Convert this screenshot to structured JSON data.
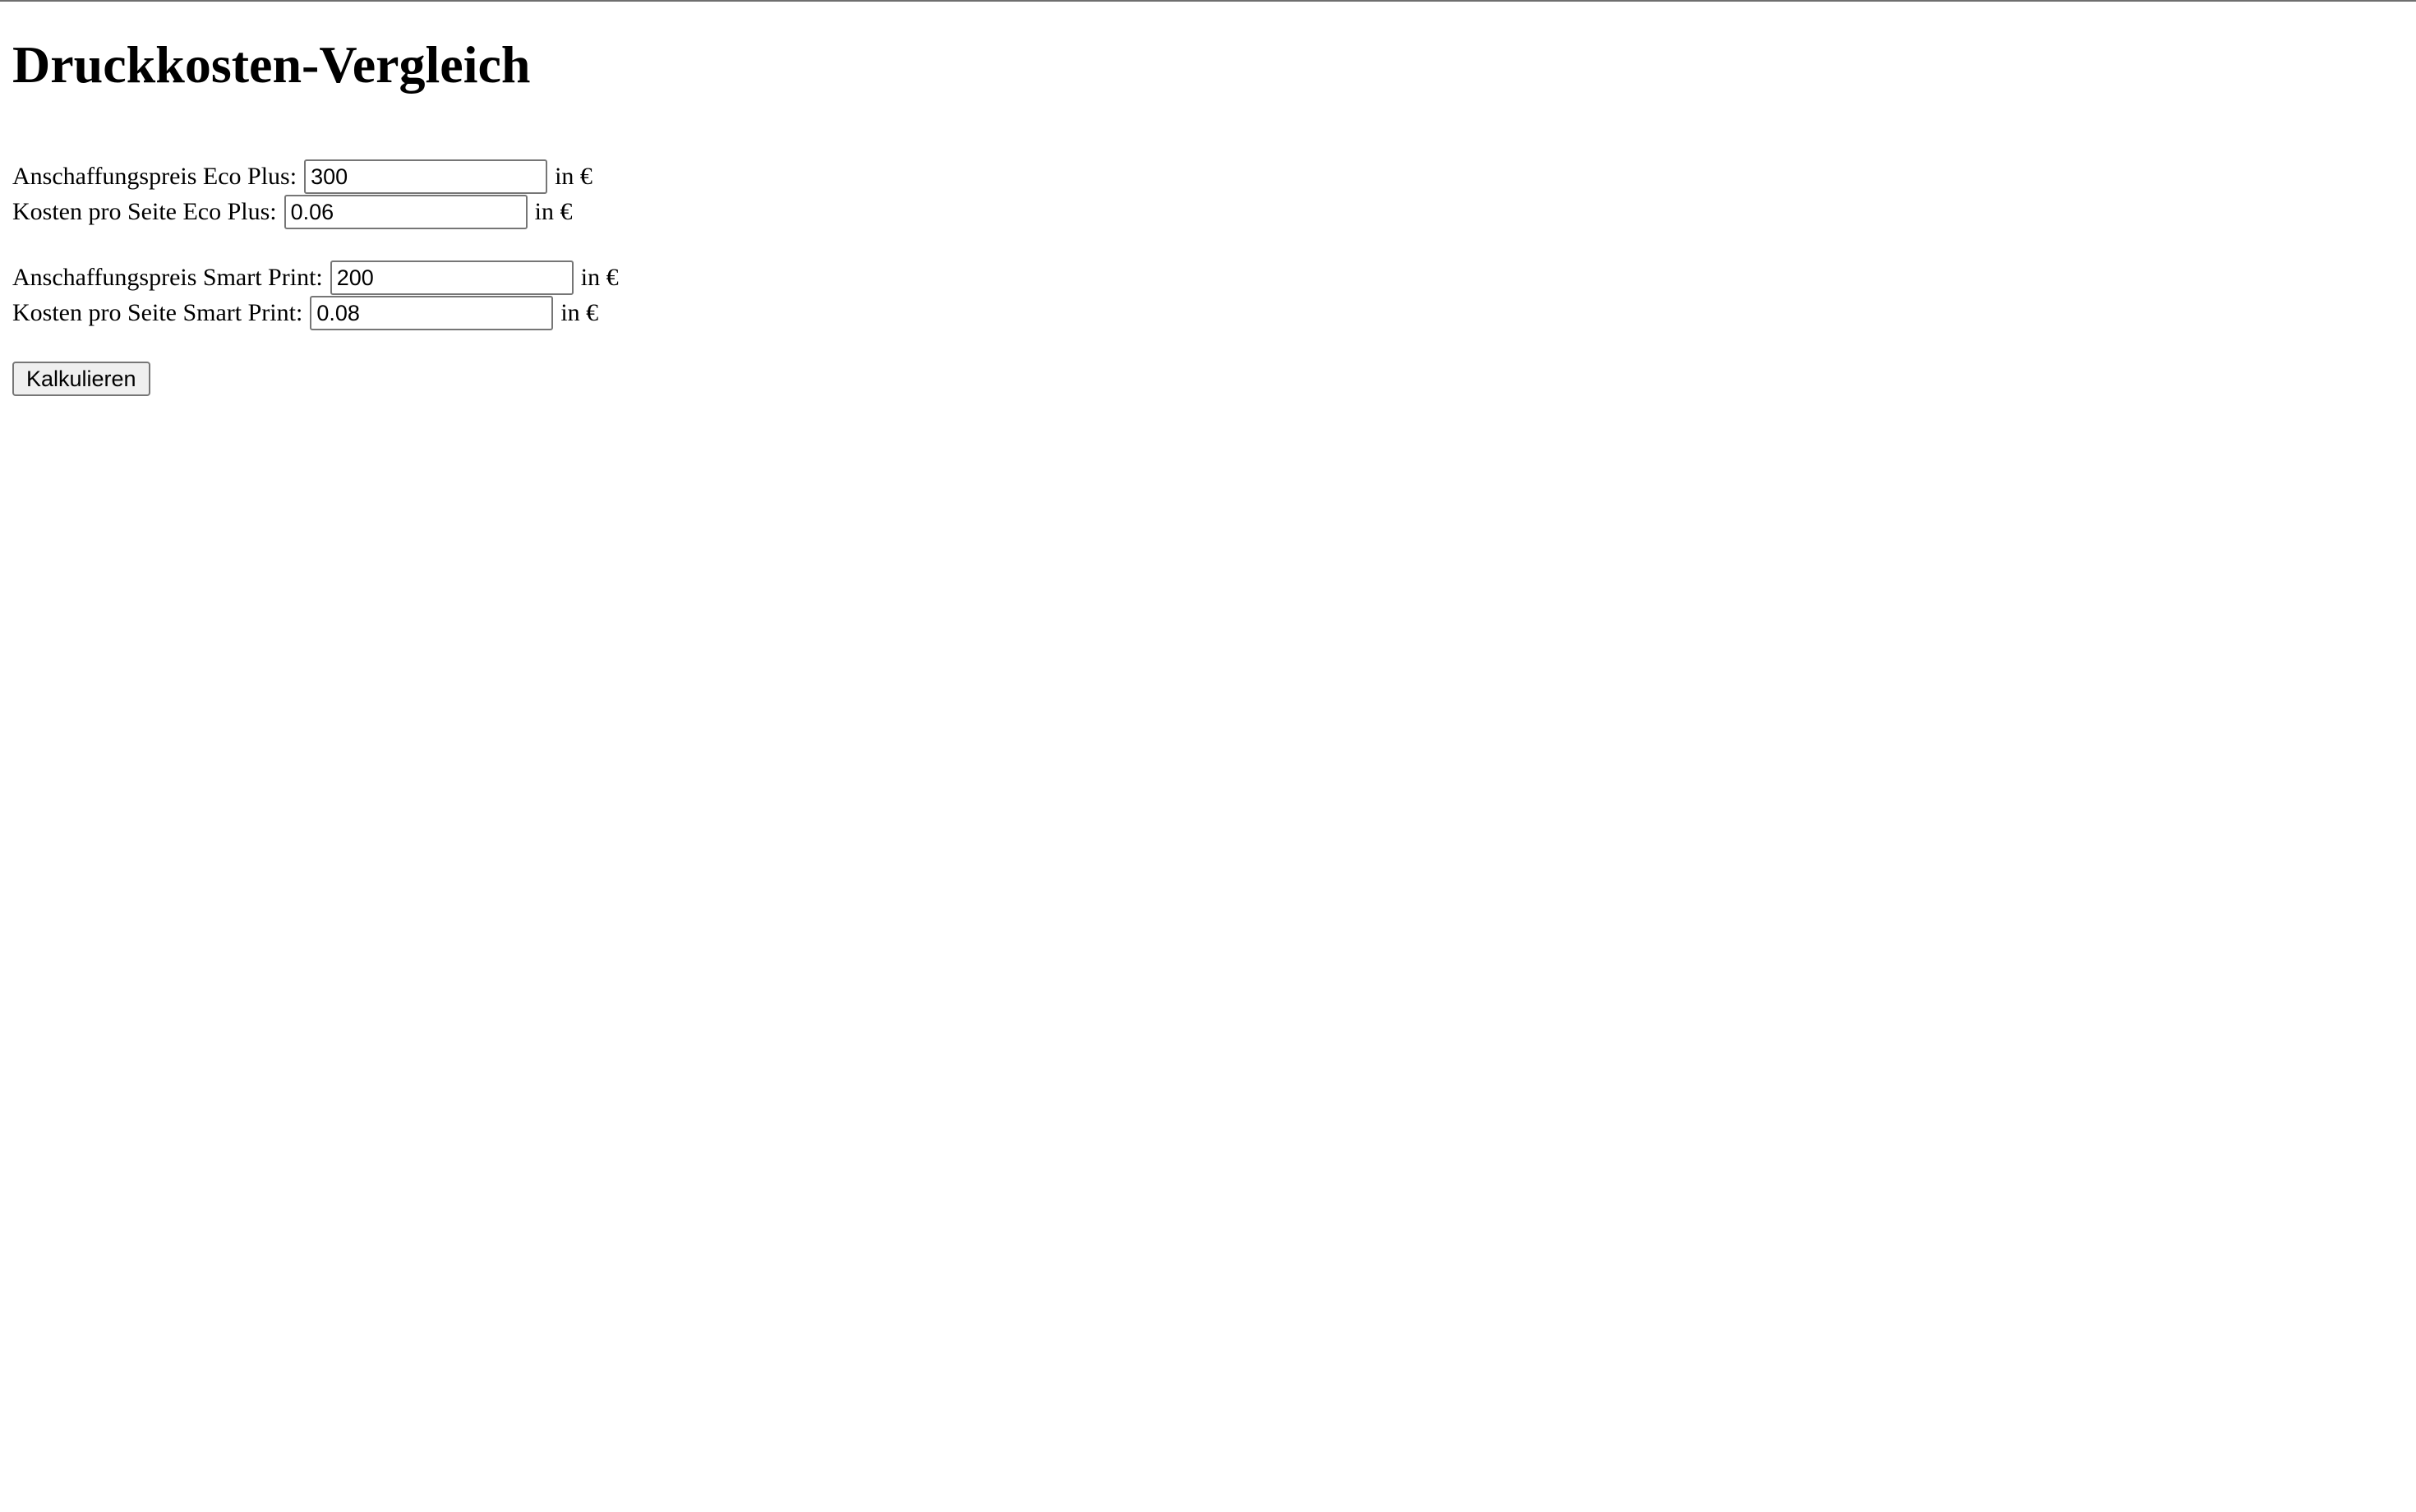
{
  "page": {
    "title": "Druckkosten-Vergleich"
  },
  "eco_plus": {
    "price_label": "Anschaffungspreis Eco Plus:",
    "price_value": "300",
    "price_unit": "in €",
    "cost_label": "Kosten pro Seite Eco Plus:",
    "cost_value": "0.06",
    "cost_unit": "in €"
  },
  "smart_print": {
    "price_label": "Anschaffungspreis Smart Print:",
    "price_value": "200",
    "price_unit": "in €",
    "cost_label": "Kosten pro Seite Smart Print:",
    "cost_value": "0.08",
    "cost_unit": "in €"
  },
  "actions": {
    "calculate_label": "Kalkulieren"
  }
}
